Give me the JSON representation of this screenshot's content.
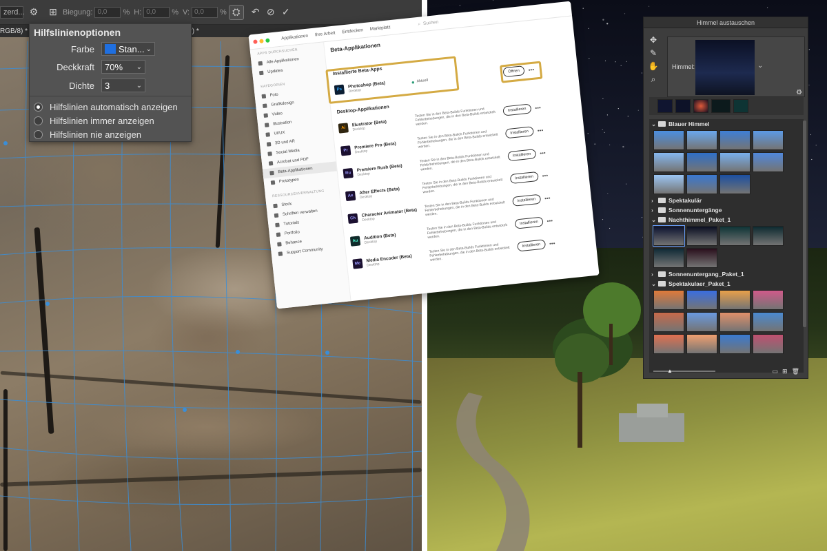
{
  "ps_toolbar": {
    "preset": "zerd...",
    "bend_label": "Biegung:",
    "bend_value": "0,0",
    "h_label": "H:",
    "h_value": "0,0",
    "v_label": "V:",
    "v_value": "0,0",
    "percent": "%"
  },
  "doc_tab": {
    "left": "RGB/8) *",
    "right": "(8*) *"
  },
  "guide_options": {
    "title": "Hilfslinienoptionen",
    "color_label": "Farbe",
    "color_value": "Stan...",
    "color_swatch": "#1f6fe0",
    "opacity_label": "Deckkraft",
    "opacity_value": "70%",
    "density_label": "Dichte",
    "density_value": "3",
    "radios": [
      {
        "label": "Hilfslinien automatisch anzeigen",
        "selected": true
      },
      {
        "label": "Hilfslinien immer anzeigen",
        "selected": false
      },
      {
        "label": "Hilfslinien nie anzeigen",
        "selected": false
      }
    ]
  },
  "cc_window": {
    "nav": [
      "Applikationen",
      "Ihre Arbeit",
      "Entdecken",
      "Marktplatz"
    ],
    "search_placeholder": "Suchen",
    "page_title": "Beta-Applikationen",
    "sidebar_heading": "APPS DURCHSUCHEN",
    "sidebar_items": [
      "Alle Applikationen",
      "Updates"
    ],
    "category_heading": "KATEGORIEN",
    "categories": [
      "Foto",
      "Grafikdesign",
      "Video",
      "Illustration",
      "UI/UX",
      "3D und AR",
      "Social Media",
      "Acrobat und PDF",
      "Beta-Applikationen",
      "Prototypen"
    ],
    "resource_heading": "RESSOURCENVERWALTUNG",
    "resources": [
      "Stock",
      "Schriften verwalten",
      "Tutorials",
      "Portfolio",
      "Behance",
      "Support Community"
    ],
    "installed_heading": "Installierte Beta-Apps",
    "installed_app": {
      "icon": "Ps",
      "name": "Photoshop (Beta)",
      "platform": "Desktop",
      "status": "Aktuell",
      "button": "Öffnen"
    },
    "desktop_heading": "Desktop-Applikationen",
    "desc": "Testen Sie in den Beta-Builds Funktionen und Fehlerbehebungen, die in den Beta-Builds entwickelt werden.",
    "install_label": "Installieren",
    "apps": [
      {
        "icon": "Ai",
        "name": "Illustrator (Beta)",
        "platform": "Desktop",
        "color": "#2f2510",
        "fg": "#ff9a00"
      },
      {
        "icon": "Pr",
        "name": "Premiere Pro (Beta)",
        "platform": "Desktop",
        "color": "#1b1030",
        "fg": "#9999ff"
      },
      {
        "icon": "Ru",
        "name": "Premiere Rush (Beta)",
        "platform": "Desktop",
        "color": "#1b1030",
        "fg": "#9999ff"
      },
      {
        "icon": "Ae",
        "name": "After Effects (Beta)",
        "platform": "Desktop",
        "color": "#1b1030",
        "fg": "#9999ff"
      },
      {
        "icon": "Ch",
        "name": "Character Animator (Beta)",
        "platform": "Desktop",
        "color": "#1b1030",
        "fg": "#9999ff"
      },
      {
        "icon": "Au",
        "name": "Audition (Beta)",
        "platform": "Desktop",
        "color": "#0f2a2a",
        "fg": "#4cffd6"
      },
      {
        "icon": "Me",
        "name": "Media Encoder (Beta)",
        "platform": "Desktop",
        "color": "#1b1030",
        "fg": "#9999ff"
      }
    ]
  },
  "sky_panel": {
    "title": "Himmel austauschen",
    "sky_label": "Himmel:",
    "folders": [
      {
        "name": "Blauer Himmel",
        "open": true,
        "count": 11,
        "tone": "blue"
      },
      {
        "name": "Spektakulär",
        "open": false
      },
      {
        "name": "Sonnenuntergänge",
        "open": false
      },
      {
        "name": "Nachthimmel_Paket_1",
        "open": true,
        "count": 6,
        "tone": "night"
      },
      {
        "name": "Sonnenuntergang_Paket_1",
        "open": false
      },
      {
        "name": "Spektakulaer_Paket_1",
        "open": true,
        "count": 12,
        "tone": "sunset"
      }
    ]
  },
  "colors": {
    "highlight": "#d4aa43",
    "guide_blue": "#3a8ed8"
  }
}
